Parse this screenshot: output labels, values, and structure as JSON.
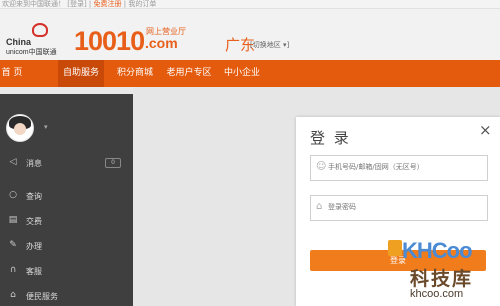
{
  "topbar": {
    "text": "欢迎来到中国联通！ [登录] |",
    "link": "免费注册",
    "tail": "| 我的订单"
  },
  "header": {
    "logo_china": "China",
    "logo_unicom": "unicom中国联通",
    "brand_number": "10010",
    "brand_tagline": "网上营业厅",
    "brand_com": ".com",
    "region": "广东",
    "switch_region": "[切换地区 ▾]"
  },
  "nav": {
    "items": [
      {
        "label": "首   页"
      },
      {
        "label": "自助服务"
      },
      {
        "label": "积分商城"
      },
      {
        "label": "老用户专区"
      },
      {
        "label": "中小企业"
      }
    ]
  },
  "sidebar": {
    "avatar_caret": "▾",
    "items": [
      {
        "icon": "speaker-icon",
        "glyph": "◁",
        "label": "消息",
        "badge": "0"
      },
      {
        "icon": "search-icon",
        "glyph": "○",
        "label": "查询"
      },
      {
        "icon": "bill-icon",
        "glyph": "▤",
        "label": "交费"
      },
      {
        "icon": "pen-icon",
        "glyph": "✎",
        "label": "办理"
      },
      {
        "icon": "headset-icon",
        "glyph": "∩",
        "label": "客服"
      },
      {
        "icon": "home-icon",
        "glyph": "⌂",
        "label": "便民服务"
      }
    ]
  },
  "login": {
    "title": "登 录",
    "close": "×",
    "phone_placeholder": "手机号码/邮箱/固网（无区号）",
    "password_placeholder": "登录密码",
    "button_label": "登录"
  },
  "watermark": {
    "brand": "KHCoo",
    "name": "科技库",
    "site": "khcoo.com"
  },
  "colors": {
    "accent": "#e45b0e",
    "button": "#f17c1c",
    "sidebar": "#3f3f3f"
  }
}
